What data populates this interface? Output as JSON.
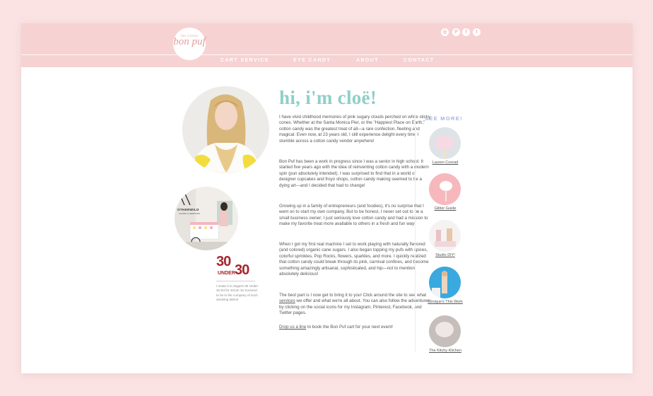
{
  "logo": {
    "small": "the cotton",
    "main": "bon puf"
  },
  "social": [
    {
      "icon": "instagram-icon",
      "glyph": "◎"
    },
    {
      "icon": "pinterest-icon",
      "glyph": "P"
    },
    {
      "icon": "facebook-icon",
      "glyph": "f"
    },
    {
      "icon": "twitter-icon",
      "glyph": "t"
    }
  ],
  "nav": [
    "CART SERVICE",
    "EYE CANDY",
    "ABOUT",
    "CONTACT"
  ],
  "cart_sign": {
    "name": "OTHERWILD",
    "sub": "GOODS & SERVICES"
  },
  "award": {
    "num1": "30",
    "under": "UNDER",
    "num2": "30",
    "caption": "I made it to Zagat's 30 Under 30 list for 2014!! So honored to be in the company of such amazing talent!"
  },
  "heading": "hi, i'm cloë!",
  "paragraphs": [
    "I have vivid childhood memories of pink sugary clouds perched on white sticky cones. Whether at the Santa Monica Pier, or the \"Happiest Place on Earth,\" cotton candy was the greatest treat of all—a rare confection, fleeting and magical. Even now, at 23 years old, I still experience delight every time I stumble across a cotton candy vendor anywhere!",
    "Bon Puf has been a work in progress since I was a senior in high school. It started five years ago with the idea of reinventing cotton candy with a modern spin (pun absolutely intended). I was surprised to find that in a world of designer cupcakes and froyo shops, cotton candy making seemed to be a dying art—and I decided that had to change!",
    "Growing up in a family of entrepreneurs (and foodies), it's no surprise that I went on to start my own company. But to be honest, I never set out to be a small business owner; I just seriously love cotton candy and had a mission to make my favorite treat more available to others in a fresh and fun way!",
    "When I got my first real machine I set to work playing with naturally flavored (and colored) organic cane sugars. I also began topping my pufs with spices, colorful sprinkles, Pop Rocks, flowers, sparkles, and more. I quickly realized that cotton candy could break through its pink, carnival confines, and become something amazingly artisanal, sophisticated, and hip—not to mention absolutely delicious!"
  ],
  "para5": {
    "before": "The best part is I now get to bring it to you! Click around the site to see what ",
    "link": "services",
    "after": " we offer and what we're all about. You can also follow the adventures by clicking on the social icons for my Instagram, Pinterest, Facebook, and Twitter pages."
  },
  "para6": {
    "link": "Drop us a line",
    "after": " to book the Bon Puf cart for your next event!"
  },
  "seemore": "SEE MORE!",
  "thumbs": [
    "Lauren Conrad",
    "Glitter Guide",
    "Studio DIY!",
    "Clinique's This Work",
    "The Kitchy Kitchen"
  ],
  "colors": {
    "accent": "#8fcfc8",
    "header": "#f6d2d3",
    "award": "#a3262e",
    "seemore": "#a6b3e0"
  }
}
